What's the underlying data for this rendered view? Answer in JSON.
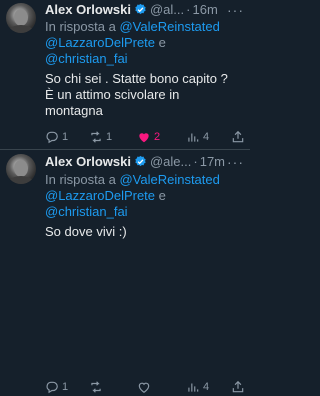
{
  "tweets": [
    {
      "name": "Alex Orlowski",
      "handle": "@al...",
      "separator": "·",
      "time": "16m",
      "reply_prefix": "In risposta a",
      "mentions": [
        "@ValeReinstated",
        "@LazzaroDelPrete",
        "@christian_fai"
      ],
      "mention_joiner": "e",
      "text_lines": [
        "So chi sei . Statte bono capito ?",
        "È un attimo scivolare in",
        "montagna"
      ],
      "replies": "1",
      "retweets": "1",
      "likes": "2",
      "views": "4"
    },
    {
      "name": "Alex Orlowski",
      "handle": "@ale...",
      "separator": "·",
      "time": "17m",
      "reply_prefix": "In risposta a",
      "mentions": [
        "@ValeReinstated",
        "@LazzaroDelPrete",
        "@christian_fai"
      ],
      "mention_joiner": "e",
      "text_lines": [
        "So dove vivi :)"
      ],
      "replies": "1",
      "retweets": "",
      "likes": "",
      "views": "4"
    }
  ],
  "colors": {
    "background": "#15202b",
    "accent": "#1d9bf0",
    "like": "#f91880",
    "muted": "#8b98a5"
  },
  "icons": [
    "verified-badge-icon",
    "more-icon",
    "reply-icon",
    "retweet-icon",
    "like-icon",
    "views-icon",
    "share-icon"
  ]
}
